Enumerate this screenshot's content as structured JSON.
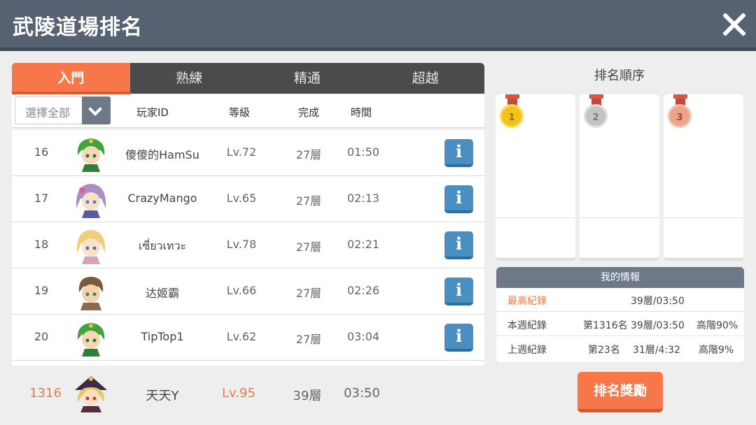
{
  "window": {
    "title": "武陵道場排名"
  },
  "tabs": [
    {
      "label": "入門",
      "active": true
    },
    {
      "label": "熟練",
      "active": false
    },
    {
      "label": "精通",
      "active": false
    },
    {
      "label": "超越",
      "active": false
    }
  ],
  "filter": {
    "selected": "選擇全部"
  },
  "columns": {
    "player": "玩家ID",
    "level": "等級",
    "done": "完成",
    "time": "時間"
  },
  "rows": [
    {
      "rank": "16",
      "name": "傻傻的HamSu",
      "level": "Lv.72",
      "done": "27層",
      "time": "01:50",
      "info": "i"
    },
    {
      "rank": "17",
      "name": "CrazyMango",
      "level": "Lv.65",
      "done": "27層",
      "time": "02:13",
      "info": "i"
    },
    {
      "rank": "18",
      "name": "เซี่ยวเทวะ",
      "level": "Lv.78",
      "done": "27層",
      "time": "02:21",
      "info": "i"
    },
    {
      "rank": "19",
      "name": "达姬霸",
      "level": "Lv.66",
      "done": "27層",
      "time": "02:26",
      "info": "i"
    },
    {
      "rank": "20",
      "name": "TipTop1",
      "level": "Lv.62",
      "done": "27層",
      "time": "03:04",
      "info": "i"
    }
  ],
  "me": {
    "rank": "1316",
    "name": "天天Y",
    "level": "Lv.95",
    "done": "39層",
    "time": "03:50"
  },
  "ranking": {
    "title": "排名順序",
    "medals": [
      "1",
      "2",
      "3"
    ]
  },
  "myinfo": {
    "title": "我的情報",
    "best_label": "最高紀錄",
    "best_value": "39層/03:50",
    "week_label": "本週紀錄",
    "week_rank": "第1316名",
    "week_value": "39層/03:50",
    "week_tier": "高階90%",
    "last_label": "上週紀錄",
    "last_rank": "第23名",
    "last_value": "31層/4:32",
    "last_tier": "高階9%"
  },
  "reward_button": "排名獎勵",
  "colors": {
    "accent": "#f7774a",
    "titlebar": "#566272",
    "info": "#4a8fc2"
  }
}
